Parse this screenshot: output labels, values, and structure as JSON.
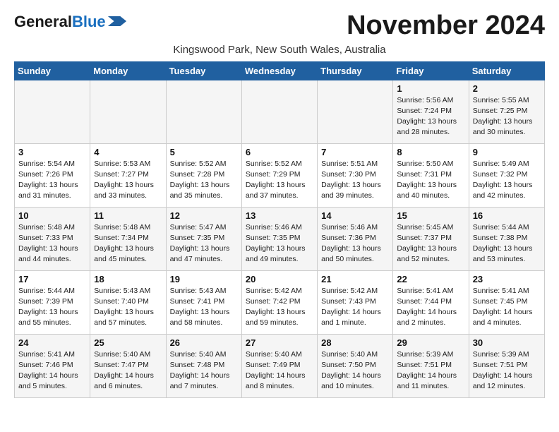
{
  "header": {
    "logo_general": "General",
    "logo_blue": "Blue",
    "month_title": "November 2024",
    "location": "Kingswood Park, New South Wales, Australia"
  },
  "weekdays": [
    "Sunday",
    "Monday",
    "Tuesday",
    "Wednesday",
    "Thursday",
    "Friday",
    "Saturday"
  ],
  "weeks": [
    [
      {
        "day": "",
        "info": ""
      },
      {
        "day": "",
        "info": ""
      },
      {
        "day": "",
        "info": ""
      },
      {
        "day": "",
        "info": ""
      },
      {
        "day": "",
        "info": ""
      },
      {
        "day": "1",
        "info": "Sunrise: 5:56 AM\nSunset: 7:24 PM\nDaylight: 13 hours\nand 28 minutes."
      },
      {
        "day": "2",
        "info": "Sunrise: 5:55 AM\nSunset: 7:25 PM\nDaylight: 13 hours\nand 30 minutes."
      }
    ],
    [
      {
        "day": "3",
        "info": "Sunrise: 5:54 AM\nSunset: 7:26 PM\nDaylight: 13 hours\nand 31 minutes."
      },
      {
        "day": "4",
        "info": "Sunrise: 5:53 AM\nSunset: 7:27 PM\nDaylight: 13 hours\nand 33 minutes."
      },
      {
        "day": "5",
        "info": "Sunrise: 5:52 AM\nSunset: 7:28 PM\nDaylight: 13 hours\nand 35 minutes."
      },
      {
        "day": "6",
        "info": "Sunrise: 5:52 AM\nSunset: 7:29 PM\nDaylight: 13 hours\nand 37 minutes."
      },
      {
        "day": "7",
        "info": "Sunrise: 5:51 AM\nSunset: 7:30 PM\nDaylight: 13 hours\nand 39 minutes."
      },
      {
        "day": "8",
        "info": "Sunrise: 5:50 AM\nSunset: 7:31 PM\nDaylight: 13 hours\nand 40 minutes."
      },
      {
        "day": "9",
        "info": "Sunrise: 5:49 AM\nSunset: 7:32 PM\nDaylight: 13 hours\nand 42 minutes."
      }
    ],
    [
      {
        "day": "10",
        "info": "Sunrise: 5:48 AM\nSunset: 7:33 PM\nDaylight: 13 hours\nand 44 minutes."
      },
      {
        "day": "11",
        "info": "Sunrise: 5:48 AM\nSunset: 7:34 PM\nDaylight: 13 hours\nand 45 minutes."
      },
      {
        "day": "12",
        "info": "Sunrise: 5:47 AM\nSunset: 7:35 PM\nDaylight: 13 hours\nand 47 minutes."
      },
      {
        "day": "13",
        "info": "Sunrise: 5:46 AM\nSunset: 7:35 PM\nDaylight: 13 hours\nand 49 minutes."
      },
      {
        "day": "14",
        "info": "Sunrise: 5:46 AM\nSunset: 7:36 PM\nDaylight: 13 hours\nand 50 minutes."
      },
      {
        "day": "15",
        "info": "Sunrise: 5:45 AM\nSunset: 7:37 PM\nDaylight: 13 hours\nand 52 minutes."
      },
      {
        "day": "16",
        "info": "Sunrise: 5:44 AM\nSunset: 7:38 PM\nDaylight: 13 hours\nand 53 minutes."
      }
    ],
    [
      {
        "day": "17",
        "info": "Sunrise: 5:44 AM\nSunset: 7:39 PM\nDaylight: 13 hours\nand 55 minutes."
      },
      {
        "day": "18",
        "info": "Sunrise: 5:43 AM\nSunset: 7:40 PM\nDaylight: 13 hours\nand 57 minutes."
      },
      {
        "day": "19",
        "info": "Sunrise: 5:43 AM\nSunset: 7:41 PM\nDaylight: 13 hours\nand 58 minutes."
      },
      {
        "day": "20",
        "info": "Sunrise: 5:42 AM\nSunset: 7:42 PM\nDaylight: 13 hours\nand 59 minutes."
      },
      {
        "day": "21",
        "info": "Sunrise: 5:42 AM\nSunset: 7:43 PM\nDaylight: 14 hours\nand 1 minute."
      },
      {
        "day": "22",
        "info": "Sunrise: 5:41 AM\nSunset: 7:44 PM\nDaylight: 14 hours\nand 2 minutes."
      },
      {
        "day": "23",
        "info": "Sunrise: 5:41 AM\nSunset: 7:45 PM\nDaylight: 14 hours\nand 4 minutes."
      }
    ],
    [
      {
        "day": "24",
        "info": "Sunrise: 5:41 AM\nSunset: 7:46 PM\nDaylight: 14 hours\nand 5 minutes."
      },
      {
        "day": "25",
        "info": "Sunrise: 5:40 AM\nSunset: 7:47 PM\nDaylight: 14 hours\nand 6 minutes."
      },
      {
        "day": "26",
        "info": "Sunrise: 5:40 AM\nSunset: 7:48 PM\nDaylight: 14 hours\nand 7 minutes."
      },
      {
        "day": "27",
        "info": "Sunrise: 5:40 AM\nSunset: 7:49 PM\nDaylight: 14 hours\nand 8 minutes."
      },
      {
        "day": "28",
        "info": "Sunrise: 5:40 AM\nSunset: 7:50 PM\nDaylight: 14 hours\nand 10 minutes."
      },
      {
        "day": "29",
        "info": "Sunrise: 5:39 AM\nSunset: 7:51 PM\nDaylight: 14 hours\nand 11 minutes."
      },
      {
        "day": "30",
        "info": "Sunrise: 5:39 AM\nSunset: 7:51 PM\nDaylight: 14 hours\nand 12 minutes."
      }
    ]
  ]
}
